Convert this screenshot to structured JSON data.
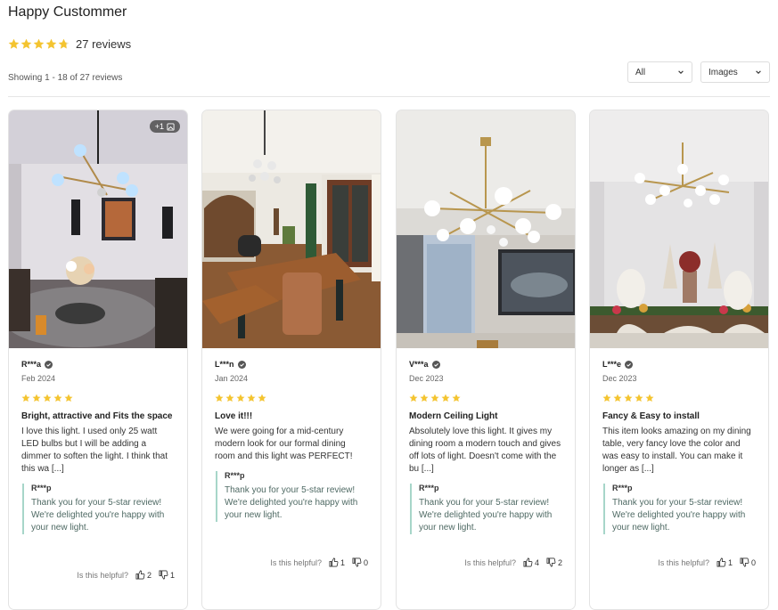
{
  "header": {
    "title": "Happy Custommer",
    "rating_value": 4.8,
    "review_count_label": "27 reviews",
    "showing_label": "Showing 1 - 18 of 27 reviews"
  },
  "filters": {
    "rating_filter": "All",
    "media_filter": "Images"
  },
  "colors": {
    "star": "#f4c430",
    "reply_border": "#a7d6c9",
    "text": "#222222"
  },
  "reviews": [
    {
      "author": "R***a",
      "date": "Feb 2024",
      "stars": 5,
      "title": "Bright, attractive and Fits the space",
      "text": "I love this light. I used only 25 watt LED bulbs but I will be adding a dimmer to soften the light. I think that this wa [...]",
      "extra_images": "+1",
      "reply_author": "R***p",
      "reply_text": "Thank you for your 5-star review! We're delighted you're happy with your new light.",
      "helpful_label": "Is this helpful?",
      "helpful_yes": "2",
      "helpful_no": "1"
    },
    {
      "author": "L***n",
      "date": "Jan 2024",
      "stars": 5,
      "title": "Love it!!!",
      "text": "We were going for a mid-century modern look for our formal dining room and this light was PERFECT!",
      "reply_author": "R***p",
      "reply_text": "Thank you for your 5-star review! We're delighted you're happy with your new light.",
      "helpful_label": "Is this helpful?",
      "helpful_yes": "1",
      "helpful_no": "0"
    },
    {
      "author": "V***a",
      "date": "Dec 2023",
      "stars": 5,
      "title": "Modern Ceiling Light",
      "text": "Absolutely love this light. It gives my dining room a modern touch and gives off lots of light. Doesn't come with the bu [...]",
      "reply_author": "R***p",
      "reply_text": "Thank you for your 5-star review! We're delighted you're happy with your new light.",
      "helpful_label": "Is this helpful?",
      "helpful_yes": "4",
      "helpful_no": "2"
    },
    {
      "author": "L***e",
      "date": "Dec 2023",
      "stars": 5,
      "title": "Fancy & Easy to install",
      "text": "This item looks amazing on my dining table, very fancy love the color and was easy to install. You can make it longer as [...]",
      "reply_author": "R***p",
      "reply_text": "Thank you for your 5-star review! We're delighted you're happy with your new light.",
      "helpful_label": "Is this helpful?",
      "helpful_yes": "1",
      "helpful_no": "0"
    }
  ]
}
